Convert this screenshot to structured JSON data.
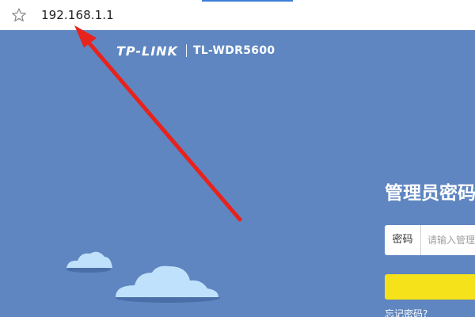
{
  "browser": {
    "url": "192.168.1.1",
    "bookmark_icon": "star-icon"
  },
  "router": {
    "brand": "TP-LINK",
    "model": "TL-WDR5600"
  },
  "login": {
    "title": "管理员密码",
    "password_label": "密码",
    "password_placeholder": "请输入管理员密码",
    "forgot_link": "忘记密码?"
  },
  "annotation": {
    "arrow_color": "#e8221c"
  },
  "colors": {
    "page_background": "#5f86c0",
    "confirm_button": "#f6e21a",
    "cloud": "#bfe1fb"
  }
}
